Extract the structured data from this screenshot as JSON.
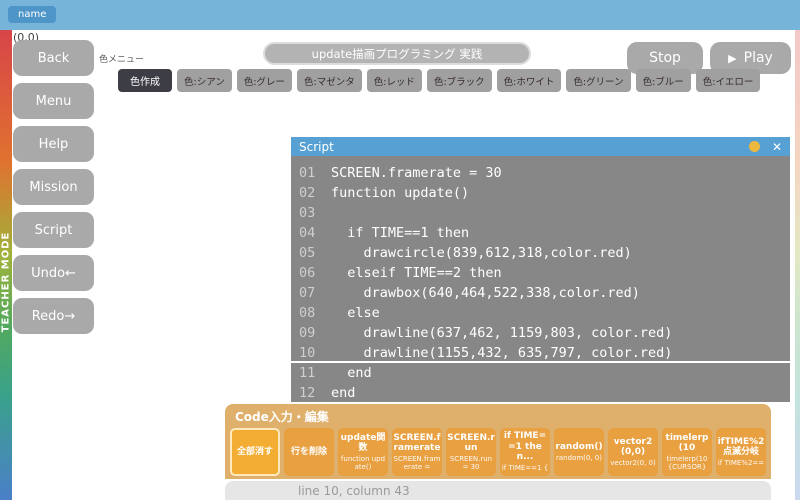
{
  "palette": {
    "top_bar_blue": "#76b4da",
    "script_header_blue": "#57a0d3",
    "panel_orange": "#d69942",
    "highlight_orange": "#f4ad33",
    "button_gray": "#a9a9a9"
  },
  "top_bar": {
    "name_label": "name"
  },
  "coords_label": "(0,0)",
  "teacher_mode_label": "TEACHER MODE",
  "sidebar": {
    "buttons": [
      {
        "label": "Back"
      },
      {
        "label": "Menu"
      },
      {
        "label": "Help"
      },
      {
        "label": "Mission"
      },
      {
        "label": "Script"
      },
      {
        "label": "Undo←"
      },
      {
        "label": "Redo→"
      }
    ]
  },
  "header": {
    "title": "update描画プログラミング 実践",
    "stop_label": "Stop",
    "play_label": "Play",
    "play_icon": "▶"
  },
  "color_menu": {
    "label": "色メニュー",
    "create_label": "色作成",
    "colors": [
      {
        "label": "色:シアン"
      },
      {
        "label": "色:グレー"
      },
      {
        "label": "色:マゼンタ"
      },
      {
        "label": "色:レッド"
      },
      {
        "label": "色:ブラック"
      },
      {
        "label": "色:ホワイト"
      },
      {
        "label": "色:グリーン"
      },
      {
        "label": "色:ブルー"
      },
      {
        "label": "色:イエロー"
      }
    ]
  },
  "script_window": {
    "title": "Script",
    "close_icon": "✕",
    "lines": [
      {
        "num": "01",
        "code": "SCREEN.framerate = 30"
      },
      {
        "num": "02",
        "code": "function update()"
      },
      {
        "num": "03",
        "code": ""
      },
      {
        "num": "04",
        "code": "  if TIME==1 then"
      },
      {
        "num": "05",
        "code": "    drawcircle(839,612,318,color.red)"
      },
      {
        "num": "06",
        "code": "  elseif TIME==2 then"
      },
      {
        "num": "07",
        "code": "    drawbox(640,464,522,338,color.red)"
      },
      {
        "num": "08",
        "code": "  else"
      },
      {
        "num": "09",
        "code": "    drawline(637,462, 1159,803, color.red)"
      },
      {
        "num": "10",
        "code": "    drawline(1155,432, 635,797, color.red)"
      },
      {
        "num": "11",
        "code": "  end"
      },
      {
        "num": "12",
        "code": "end"
      }
    ],
    "cursor_line": 10
  },
  "code_panel": {
    "title": "Code入力・編集",
    "buttons": [
      {
        "label": "全部消す",
        "sub": "",
        "highlighted": true
      },
      {
        "label": "行を削除",
        "sub": ""
      },
      {
        "label": "update関数",
        "sub": "function update()"
      },
      {
        "label": "SCREEN.framerate",
        "sub": "SCREEN.framerate ="
      },
      {
        "label": "SCREEN.run",
        "sub": "SCREEN.run = 30"
      },
      {
        "label": "if TIME==1 then...",
        "sub": "if TIME==1 {"
      },
      {
        "label": "random()",
        "sub": "random(0, 0)"
      },
      {
        "label": "vector2(0,0)",
        "sub": "vector2(0, 0)"
      },
      {
        "label": "timelerp(10",
        "sub": "timelerp(10 {CURSOR}"
      },
      {
        "label": "ifTIME%2点滅分岐",
        "sub": "if TIME%2=="
      }
    ]
  },
  "status_bar": {
    "text": "line 10, column 43"
  }
}
